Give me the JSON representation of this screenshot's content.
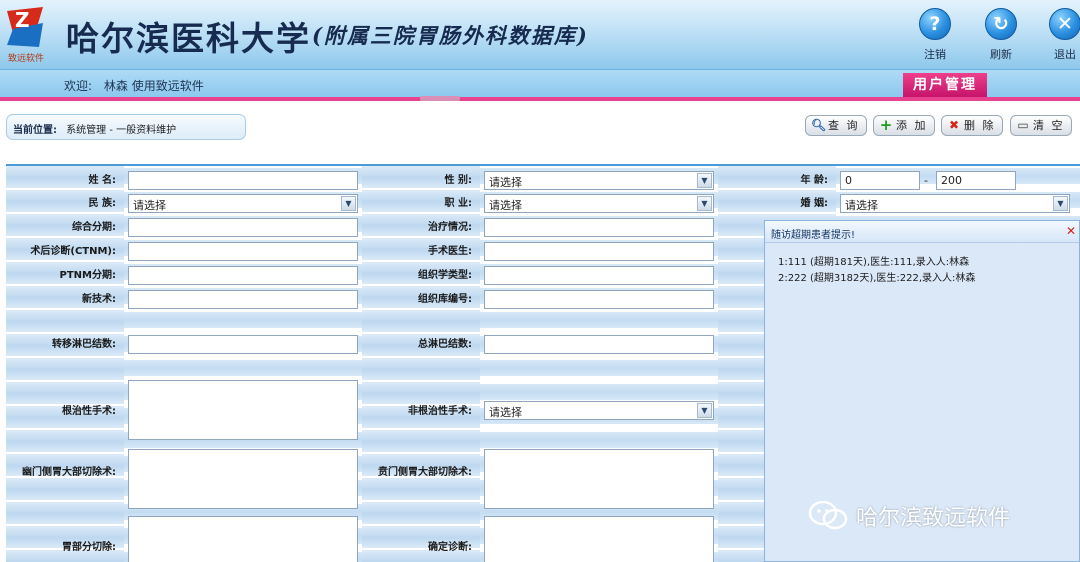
{
  "header": {
    "title": "哈尔滨医科大学",
    "subtitle": "(附属三院胃肠外科数据库)",
    "logo_text": "致远软件",
    "buttons": [
      {
        "label": "注销",
        "icon": "help-icon"
      },
      {
        "label": "刷新",
        "icon": "refresh-icon"
      },
      {
        "label": "退出",
        "icon": "close-icon"
      }
    ]
  },
  "welcome": {
    "prefix": "欢迎:",
    "text": "林森 使用致远软件",
    "user_tab": "用户管理"
  },
  "breadcrumb": {
    "label": "当前位置:",
    "path": "系统管理 - 一般资料维护"
  },
  "toolbar": {
    "query": "查 询",
    "add": "添 加",
    "delete": "删 除",
    "clear": "清 空"
  },
  "form": {
    "name_label": "姓  名:",
    "gender_label": "性 别:",
    "gender_value": "请选择",
    "age_label": "年 龄:",
    "age_min": "0",
    "age_max": "200",
    "age_sep": "-",
    "ethnicity_label": "民 族:",
    "ethnicity_value": "请选择",
    "occupation_label": "职 业:",
    "occupation_value": "请选择",
    "marriage_label": "婚 姻:",
    "marriage_value": "请选择",
    "stage_label": "综合分期:",
    "treatment_label": "治疗情况:",
    "post_diag_label": "术后诊断(CTNM):",
    "surgeon_label": "手术医生:",
    "ptnm_label": "PTNM分期:",
    "histology_label": "组织学类型:",
    "new_tech_label": "新技术:",
    "tissue_no_label": "组织库编号:",
    "mets_nodes_label": "转移淋巴结数:",
    "total_nodes_label": "总淋巴结数:",
    "radical_label": "根治性手术:",
    "nonradical_label": "非根治性手术:",
    "nonradical_value": "请选择",
    "pylorus_label": "幽门侧胃大部切除术:",
    "cardia_label": "贲门侧胃大部切除术:",
    "partial_label": "胃部分切除:",
    "diagnosis_label": "确定诊断:"
  },
  "popup": {
    "title": "随访超期患者提示!",
    "lines": [
      "1:111 (超期181天),医生:111,录入人:林森",
      "2:222 (超期3182天),医生:222,录入人:林森"
    ]
  },
  "watermark": "哈尔滨致远软件",
  "colors": {
    "accent_pink": "#e8438f",
    "header_blue": "#8ec8ec",
    "form_border": "#4d9ad8"
  }
}
